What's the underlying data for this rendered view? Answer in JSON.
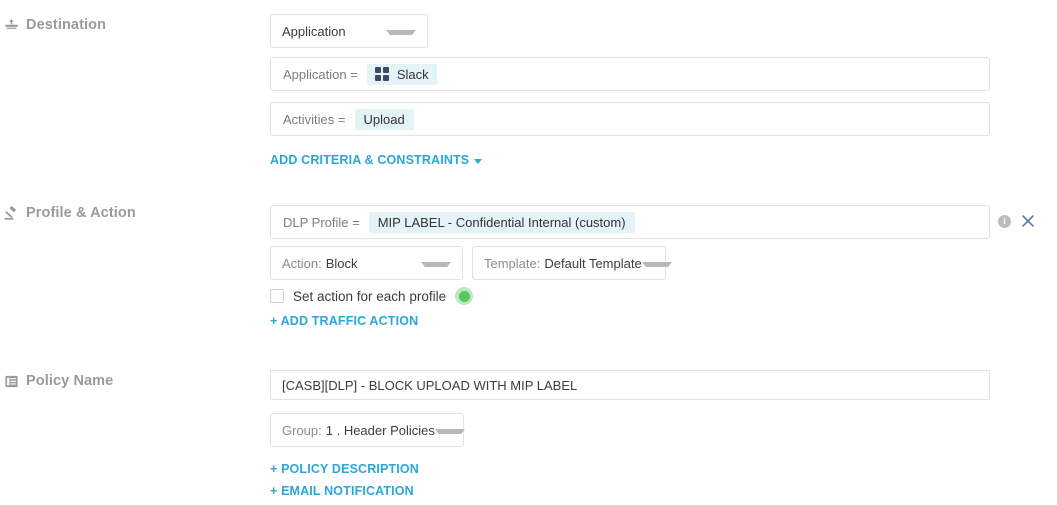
{
  "sections": {
    "destination": {
      "label": "Destination",
      "icon": "upload-destination-icon",
      "type_select": {
        "value": "Application"
      },
      "criteria": [
        {
          "label": "Application =",
          "chip": "Slack",
          "chip_icon": "slack-grid-icon"
        },
        {
          "label": "Activities =",
          "chip": "Upload",
          "chip_icon": ""
        }
      ],
      "add_criteria_link": "ADD CRITERIA & CONSTRAINTS"
    },
    "profile_action": {
      "label": "Profile & Action",
      "icon": "gavel-icon",
      "dlp_profile": {
        "label": "DLP Profile =",
        "chip": "MIP LABEL - Confidential Internal (custom)"
      },
      "action_select": {
        "prefix": "Action:",
        "value": "Block"
      },
      "template_select": {
        "prefix": "Template:",
        "value": "Default Template"
      },
      "set_action_checkbox": {
        "label": "Set action for each profile",
        "checked": false,
        "status": "enabled"
      },
      "add_traffic_action_link": "+ ADD TRAFFIC ACTION",
      "row_icons": {
        "info": "info-icon",
        "close": "close-icon"
      }
    },
    "policy_name": {
      "label": "Policy Name",
      "icon": "document-list-icon",
      "name_input": {
        "value": "[CASB][DLP] - BLOCK UPLOAD WITH MIP LABEL",
        "placeholder": "Policy Name"
      },
      "group_select": {
        "prefix": "Group:",
        "value": "1 . Header Policies"
      },
      "policy_description_link": "+ POLICY DESCRIPTION",
      "email_notification_link": "+ EMAIL NOTIFICATION"
    }
  },
  "colors": {
    "link": "#2ba6dd",
    "chip_bg": "#e3f3f8",
    "label": "#9a9a9a",
    "border": "#e2e2e2",
    "status_green": "#5cc45f"
  }
}
